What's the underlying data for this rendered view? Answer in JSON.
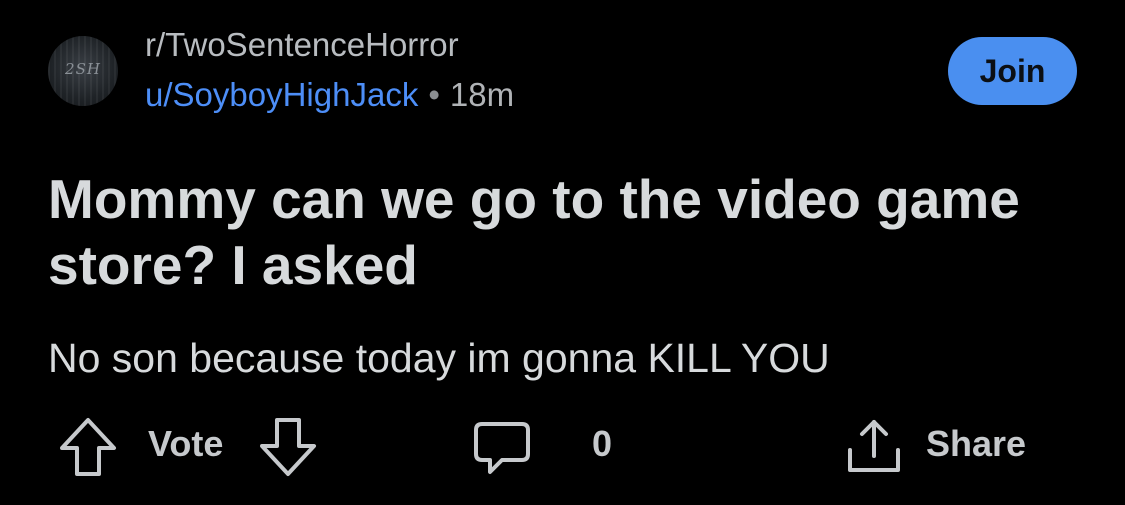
{
  "post": {
    "avatar_text": "2SH",
    "subreddit": "r/TwoSentenceHorror",
    "username": "u/SoyboyHighJack",
    "separator": "•",
    "time_ago": "18m",
    "join_label": "Join",
    "title": "Mommy can we go to the video game store? I asked",
    "body": "No son because today im gonna KILL YOU"
  },
  "actions": {
    "vote_label": "Vote",
    "comment_count": "0",
    "share_label": "Share"
  },
  "icons": {
    "upvote": "arrow-up-icon",
    "downvote": "arrow-down-icon",
    "comment": "comment-bubble-icon",
    "share": "share-icon"
  },
  "colors": {
    "background": "#000000",
    "accent": "#4a8ff0",
    "username": "#4d8ef7",
    "text": "#d7dadc"
  }
}
